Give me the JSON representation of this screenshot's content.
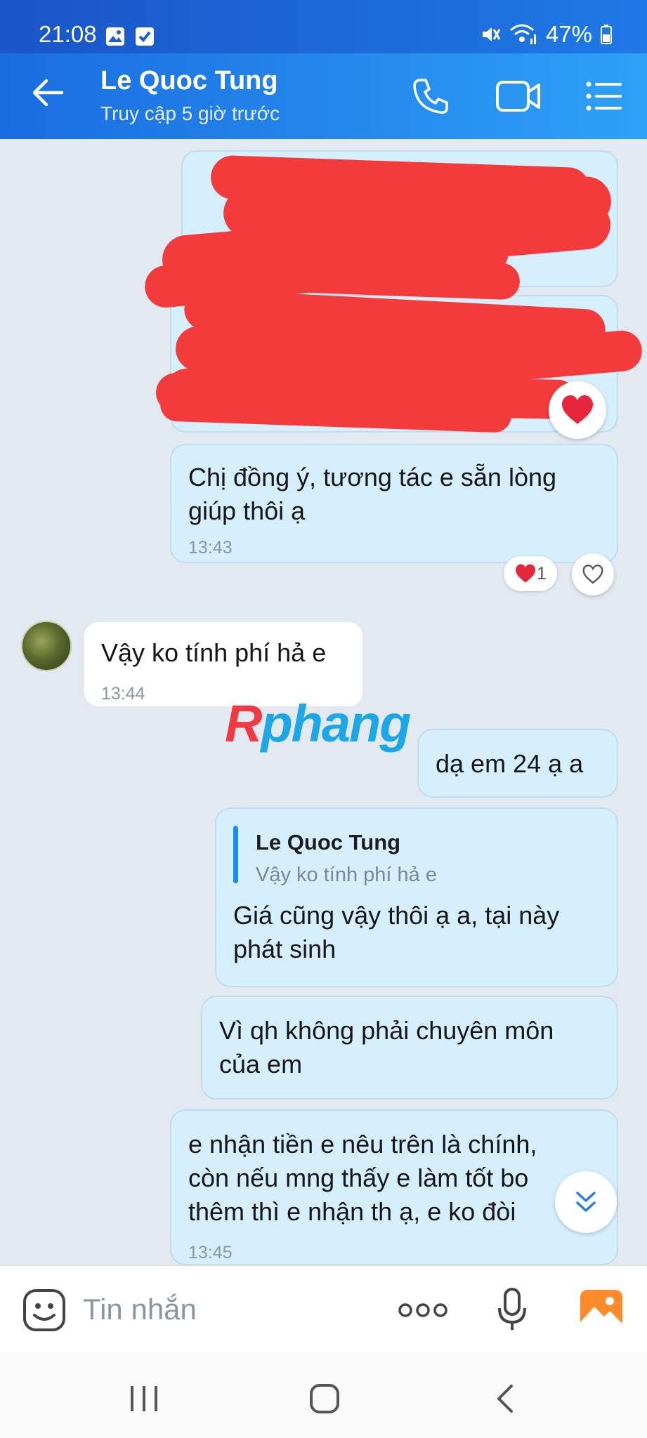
{
  "status_bar": {
    "time": "21:08",
    "battery": "47%"
  },
  "header": {
    "contact_name": "Le Quoc Tung",
    "last_seen": "Truy cập 5 giờ trước"
  },
  "messages": [
    {
      "direction": "out",
      "text_lines": [
        "Chị đồng ý, tương tác e sẵn lòng",
        "giúp thôi ạ"
      ],
      "time": "13:43",
      "reaction_count": "1"
    },
    {
      "direction": "in",
      "text_lines": [
        "Vậy ko tính phí hả e"
      ],
      "time": "13:44"
    },
    {
      "direction": "out",
      "text_lines": [
        "dạ em 24 ạ a"
      ]
    },
    {
      "direction": "out",
      "quote": {
        "name": "Le Quoc Tung",
        "text": "Vậy ko tính phí hả e"
      },
      "text_lines": [
        "Giá cũng vậy thôi ạ a, tại này",
        "phát sinh"
      ]
    },
    {
      "direction": "out",
      "text_lines": [
        "Vì qh không phải chuyên môn",
        "của em"
      ]
    },
    {
      "direction": "out",
      "text_lines": [
        "e nhận tiền e nêu trên là chính,",
        "còn nếu mng thấy e làm tốt bo",
        "thêm thì e nhận th ạ, e ko đòi"
      ],
      "time": "13:45"
    }
  ],
  "watermark": {
    "part1": "R",
    "part2": "phang"
  },
  "composer": {
    "placeholder": "Tin nhắn"
  },
  "colors": {
    "header": "#1f79e6",
    "bubble_out": "#d5efff",
    "bubble_in": "#ffffff",
    "heart": "#e5263d",
    "redaction": "#f43b3b"
  },
  "icons": [
    "back-arrow-icon",
    "phone-icon",
    "video-call-icon",
    "list-menu-icon",
    "heart-icon",
    "scroll-down-icon",
    "sticker-icon",
    "more-options-icon",
    "microphone-icon",
    "image-icon",
    "recent-apps-icon",
    "home-icon",
    "nav-back-icon"
  ]
}
